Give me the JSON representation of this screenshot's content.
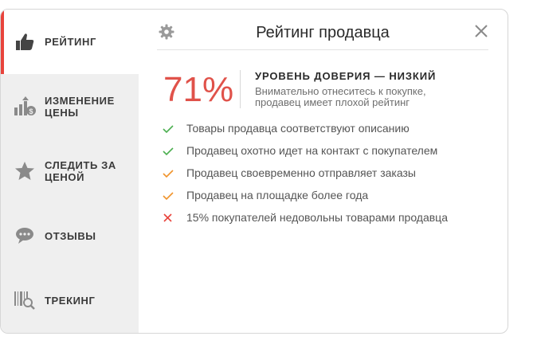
{
  "sidebar": {
    "items": [
      {
        "label": "РЕЙТИНГ",
        "icon": "thumbs-up-icon"
      },
      {
        "label": "ИЗМЕНЕНИЕ\nЦЕНЫ",
        "icon": "price-change-chart-icon"
      },
      {
        "label": "СЛЕДИТЬ ЗА\nЦЕНОЙ",
        "icon": "star-icon"
      },
      {
        "label": "ОТЗЫВЫ",
        "icon": "chat-bubble-icon"
      },
      {
        "label": "ТРЕКИНГ",
        "icon": "barcode-search-icon"
      }
    ]
  },
  "header": {
    "title": "Рейтинг продавца"
  },
  "rating": {
    "score": "71%",
    "trust_title": "УРОВЕНЬ ДОВЕРИЯ — НИЗКИЙ",
    "trust_desc": "Внимательно отнеситесь к покупке, продавец имеет плохой рейтинг"
  },
  "facts": [
    {
      "text": "Товары продавца соответствуют описанию",
      "status": "good"
    },
    {
      "text": "Продавец охотно идет на контакт с покупателем",
      "status": "good"
    },
    {
      "text": "Продавец своевременно отправляет заказы",
      "status": "warn"
    },
    {
      "text": "Продавец на площадке более года",
      "status": "warn"
    },
    {
      "text": "15% покупателей недовольны товарами продавца",
      "status": "bad"
    }
  ],
  "colors": {
    "accent": "#e8443c",
    "score": "#e0524a",
    "good": "#4caf50",
    "warn": "#f0932b",
    "bad": "#e8443c"
  }
}
